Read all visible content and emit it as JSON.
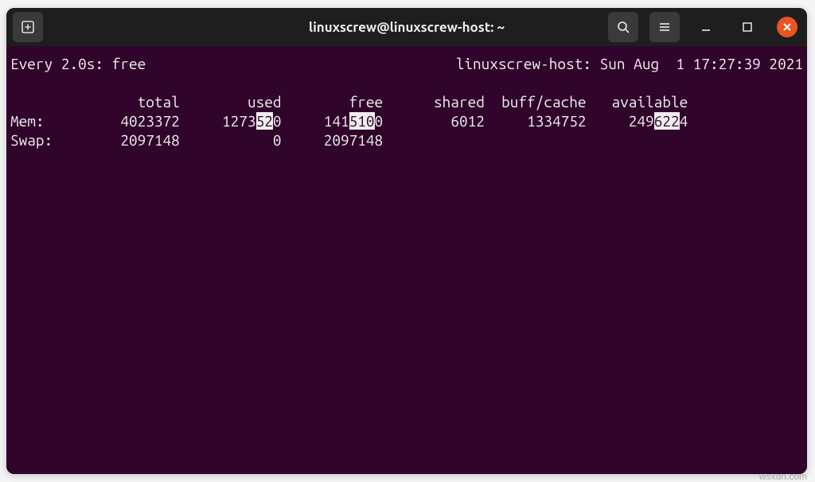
{
  "title": "linuxscrew@linuxscrew-host: ~",
  "watermark": "wsxdn.com",
  "watch_left": "Every 2.0s: free",
  "watch_right": "linuxscrew-host: Sun Aug  1 17:27:39 2021",
  "cols": {
    "c1": "total",
    "c2": "used",
    "c3": "free",
    "c4": "shared",
    "c5": "buff/cache",
    "c6": "available"
  },
  "mem": {
    "label": "Mem:",
    "total": "4023372",
    "used_a": "1273",
    "used_b": "52",
    "used_c": "0",
    "free_a": "141",
    "free_b": "510",
    "free_c": "0",
    "shared": "6012",
    "buff": "1334752",
    "avail_a": "249",
    "avail_b": "622",
    "avail_c": "4"
  },
  "swap": {
    "label": "Swap:",
    "total": "2097148",
    "used": "0",
    "free": "2097148"
  }
}
